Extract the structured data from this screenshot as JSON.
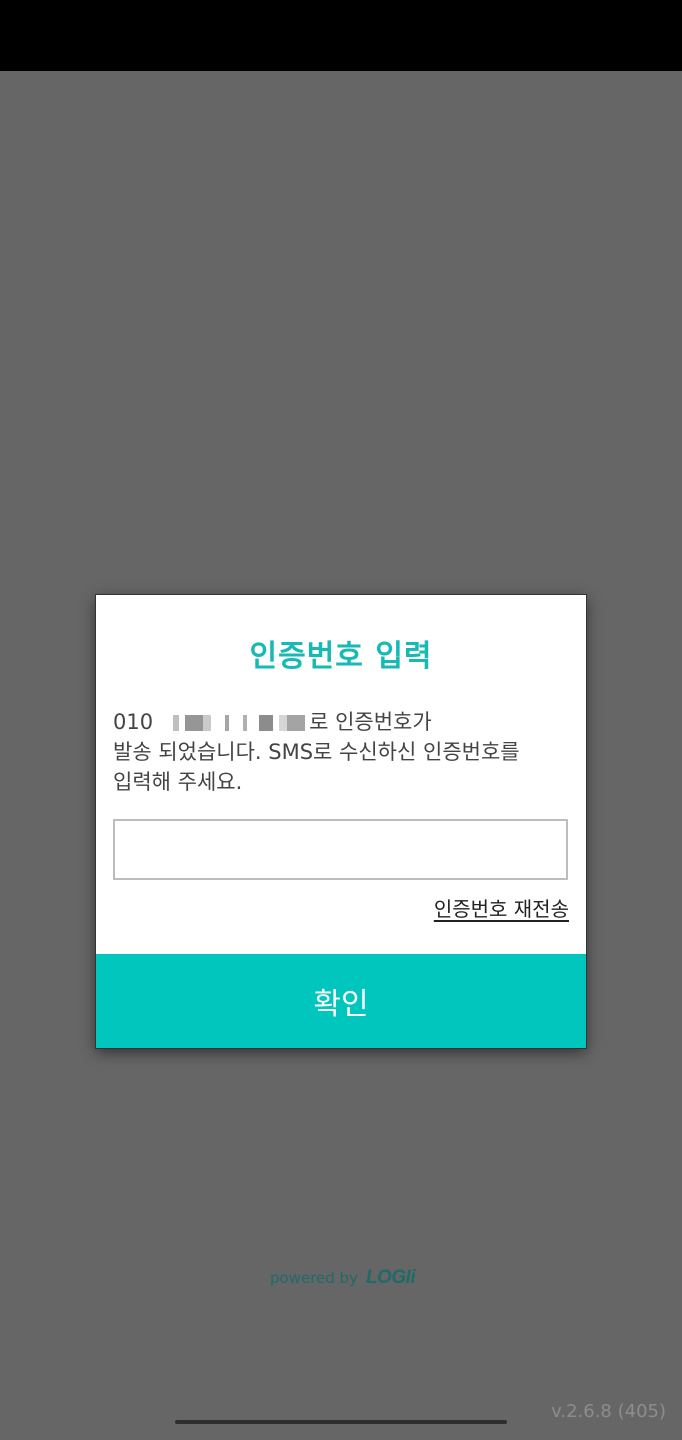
{
  "dialog": {
    "title": "인증번호 입력",
    "message_prefix": "010",
    "message_line1_suffix": "로 인증번호가",
    "message_line2": "발송 되었습니다. SMS로 수신하신 인증번호를",
    "message_line3": "입력해 주세요.",
    "code_input_value": "",
    "resend_label": "인증번호 재전송",
    "confirm_label": "확인"
  },
  "footer": {
    "powered_by": "powered by",
    "logo": "LOGIi",
    "version": "v.2.6.8 (405)"
  },
  "colors": {
    "accent": "#00c6be",
    "title": "#17b9b3",
    "overlay": "#666666"
  }
}
